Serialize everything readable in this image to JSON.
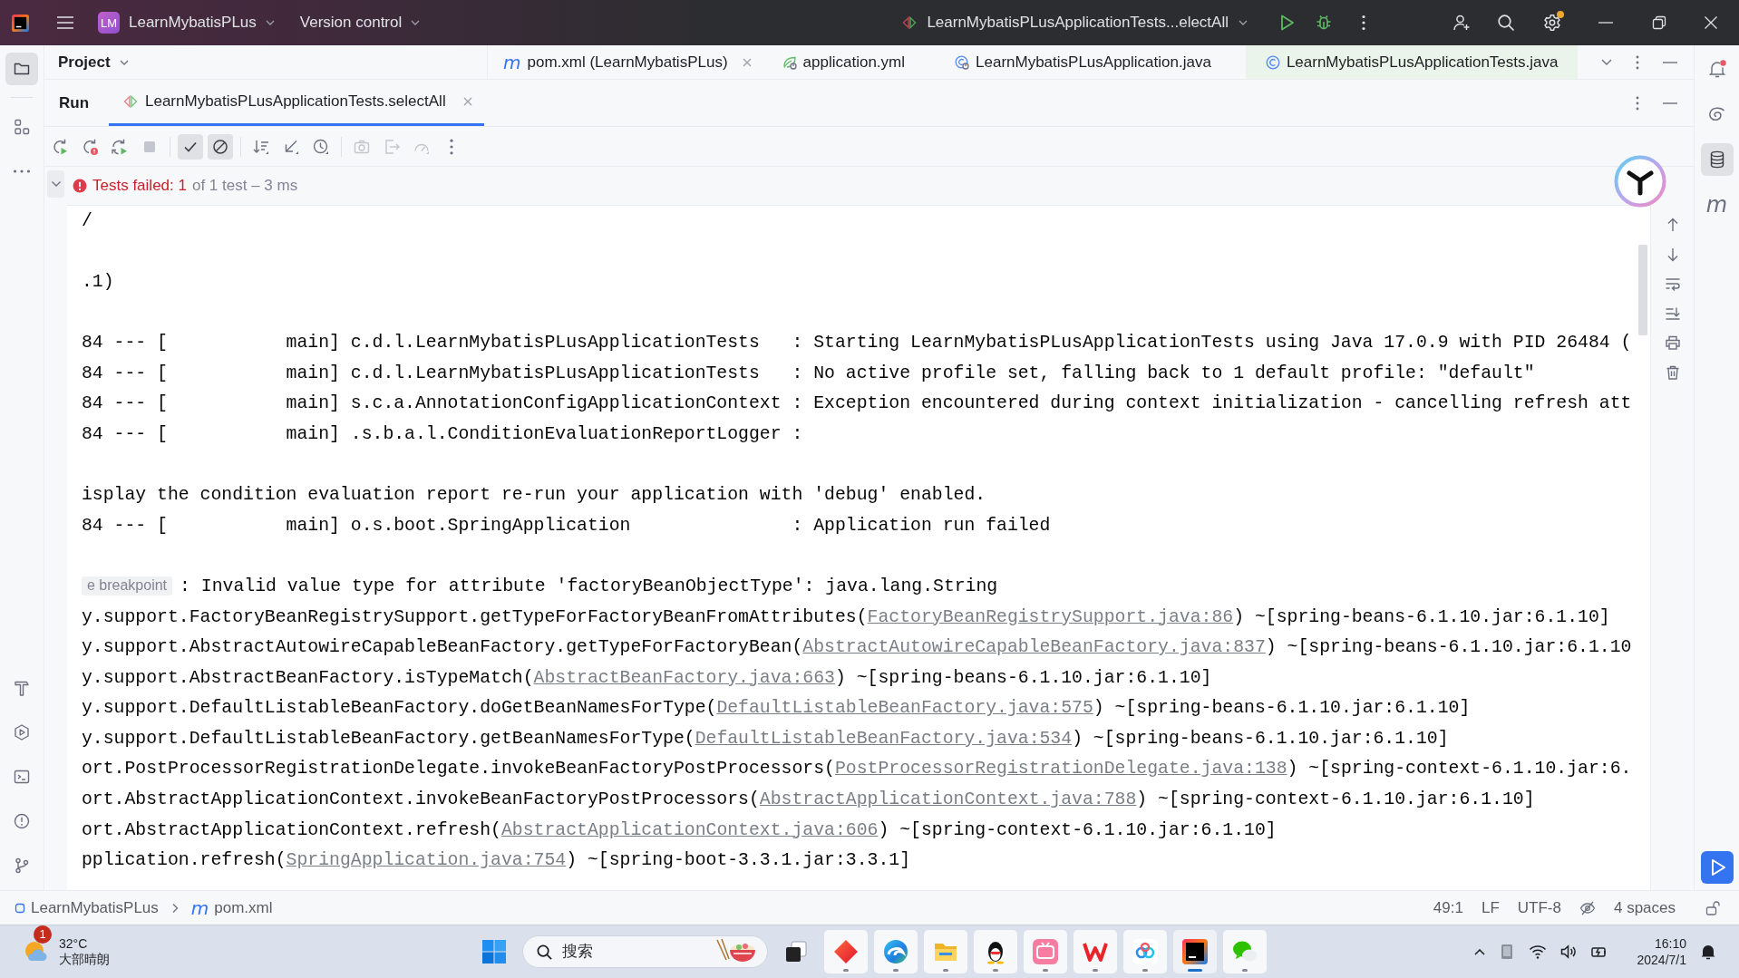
{
  "title_bar": {
    "project_badge": "LM",
    "project": "LearnMybatisPLus",
    "vcs": "Version control",
    "run_config": "LearnMybatisPLusApplicationTests...electAll",
    "settings_badge": true
  },
  "left_toolbar": [
    {
      "selected": true
    },
    {
      "selected": false
    },
    {
      "selected": false
    },
    {
      "selected": false
    },
    {
      "selected": false
    },
    {
      "selected": false
    },
    {
      "selected": false
    },
    {
      "selected": false
    }
  ],
  "project_panel": {
    "title": "Project"
  },
  "editor_tabs": [
    {
      "kind": "pom",
      "glyph": "m",
      "label": "pom.xml (LearnMybatisPLus)",
      "selected": false,
      "closable": true
    },
    {
      "kind": "config",
      "label": "application.yml",
      "selected": false,
      "closable": false
    },
    {
      "kind": "main-class",
      "label": "LearnMybatisPLusApplication.java",
      "selected": false,
      "closable": false
    },
    {
      "kind": "class",
      "label": "LearnMybatisPLusApplicationTests.java",
      "selected": true,
      "closable": false
    }
  ],
  "run_panel": {
    "title": "Run",
    "tab": {
      "label": "LearnMybatisPLusApplicationTests.selectAll",
      "selected": true,
      "closable": true
    }
  },
  "run_toolbar": [
    {
      "disabled": false,
      "selected": false
    },
    {
      "disabled": false,
      "selected": false
    },
    {
      "disabled": false,
      "selected": false
    },
    {
      "disabled": true,
      "selected": false
    },
    {
      "disabled": false,
      "selected": true
    },
    {
      "disabled": false,
      "selected": true
    },
    {
      "disabled": false,
      "selected": false
    },
    {
      "disabled": false,
      "selected": false
    },
    {
      "disabled": false,
      "selected": false
    },
    {
      "disabled": true,
      "selected": false
    },
    {
      "disabled": true,
      "selected": false
    },
    {
      "disabled": true,
      "selected": false
    },
    {
      "disabled": false,
      "selected": false
    }
  ],
  "test_status": {
    "failed": true,
    "expanded": true,
    "summary": "Tests failed: 1",
    "detail": "of 1 test – 3 ms"
  },
  "console": {
    "lines": [
      {
        "segments": [
          {
            "kind": "code",
            "text": "/"
          }
        ]
      },
      {
        "blank_line_before": true,
        "segments": [
          {
            "kind": "code",
            "text": ".1)"
          }
        ]
      },
      {
        "blank_line_before": true,
        "segments": [
          {
            "kind": "code",
            "text": "84 --- [           main] c.d.l.LearnMybatisPLusApplicationTests   : Starting LearnMybatisPLusApplicationTests using Java 17.0.9 with PID 26484 ("
          }
        ]
      },
      {
        "segments": [
          {
            "kind": "code",
            "text": "84 --- [           main] c.d.l.LearnMybatisPLusApplicationTests   : No active profile set, falling back to 1 default profile: \"default\""
          }
        ]
      },
      {
        "segments": [
          {
            "kind": "code",
            "text": "84 --- [           main] s.c.a.AnnotationConfigApplicationContext : Exception encountered during context initialization - cancelling refresh att"
          }
        ]
      },
      {
        "segments": [
          {
            "kind": "code",
            "text": "84 --- [           main] .s.b.a.l.ConditionEvaluationReportLogger :"
          }
        ]
      },
      {
        "blank_line_before": true,
        "segments": [
          {
            "kind": "code",
            "text": "isplay the condition evaluation report re-run your application with 'debug' enabled."
          }
        ]
      },
      {
        "segments": [
          {
            "kind": "code",
            "text": "84 --- [           main] o.s.boot.SpringApplication               : Application run failed"
          }
        ]
      },
      {
        "blank_line_before": true,
        "segments": [
          {
            "kind": "hint",
            "text": "e breakpoint"
          },
          {
            "kind": "code",
            "text": ": Invalid value type for attribute 'factoryBeanObjectType': java.lang.String"
          }
        ]
      },
      {
        "segments": [
          {
            "kind": "code",
            "text": "y.support.FactoryBeanRegistrySupport.getTypeForFactoryBeanFromAttributes("
          },
          {
            "kind": "link",
            "text": "FactoryBeanRegistrySupport.java:86"
          },
          {
            "kind": "code",
            "text": ") ~[spring-beans-6.1.10.jar:6.1.10]"
          }
        ]
      },
      {
        "segments": [
          {
            "kind": "code",
            "text": "y.support.AbstractAutowireCapableBeanFactory.getTypeForFactoryBean("
          },
          {
            "kind": "link",
            "text": "AbstractAutowireCapableBeanFactory.java:837"
          },
          {
            "kind": "code",
            "text": ") ~[spring-beans-6.1.10.jar:6.1.10"
          }
        ]
      },
      {
        "segments": [
          {
            "kind": "code",
            "text": "y.support.AbstractBeanFactory.isTypeMatch("
          },
          {
            "kind": "link",
            "text": "AbstractBeanFactory.java:663"
          },
          {
            "kind": "code",
            "text": ") ~[spring-beans-6.1.10.jar:6.1.10]"
          }
        ]
      },
      {
        "segments": [
          {
            "kind": "code",
            "text": "y.support.DefaultListableBeanFactory.doGetBeanNamesForType("
          },
          {
            "kind": "link",
            "text": "DefaultListableBeanFactory.java:575"
          },
          {
            "kind": "code",
            "text": ") ~[spring-beans-6.1.10.jar:6.1.10]"
          }
        ]
      },
      {
        "segments": [
          {
            "kind": "code",
            "text": "y.support.DefaultListableBeanFactory.getBeanNamesForType("
          },
          {
            "kind": "link",
            "text": "DefaultListableBeanFactory.java:534"
          },
          {
            "kind": "code",
            "text": ") ~[spring-beans-6.1.10.jar:6.1.10]"
          }
        ]
      },
      {
        "segments": [
          {
            "kind": "code",
            "text": "ort.PostProcessorRegistrationDelegate.invokeBeanFactoryPostProcessors("
          },
          {
            "kind": "link",
            "text": "PostProcessorRegistrationDelegate.java:138"
          },
          {
            "kind": "code",
            "text": ") ~[spring-context-6.1.10.jar:6."
          }
        ]
      },
      {
        "segments": [
          {
            "kind": "code",
            "text": "ort.AbstractApplicationContext.invokeBeanFactoryPostProcessors("
          },
          {
            "kind": "link",
            "text": "AbstractApplicationContext.java:788"
          },
          {
            "kind": "code",
            "text": ") ~[spring-context-6.1.10.jar:6.1.10]"
          }
        ]
      },
      {
        "segments": [
          {
            "kind": "code",
            "text": "ort.AbstractApplicationContext.refresh("
          },
          {
            "kind": "link",
            "text": "AbstractApplicationContext.java:606"
          },
          {
            "kind": "code",
            "text": ") ~[spring-context-6.1.10.jar:6.1.10]"
          }
        ]
      },
      {
        "segments": [
          {
            "kind": "code",
            "text": "pplication.refresh("
          },
          {
            "kind": "link",
            "text": "SpringApplication.java:754"
          },
          {
            "kind": "code",
            "text": ") ~[spring-boot-3.3.1.jar:3.3.1]"
          }
        ]
      }
    ]
  },
  "right_toolbar": [
    {
      "selected": false,
      "unread": true
    },
    {
      "selected": false
    },
    {
      "selected": true
    },
    {
      "selected": false,
      "glyph": "m"
    }
  ],
  "status_bar": {
    "breadcrumbs": [
      {
        "kind": "module",
        "label": "LearnMybatisPLus"
      },
      {
        "kind": "pom",
        "glyph": "m",
        "label": "pom.xml"
      }
    ],
    "position": "49:1",
    "line_separator": "LF",
    "encoding": "UTF-8",
    "indent": "4 spaces"
  },
  "taskbar": {
    "weather": {
      "badge": "1",
      "temperature": "32°C",
      "condition": "大部晴朗"
    },
    "search": {
      "placeholder": "搜索"
    },
    "apps": [
      {
        "running": true,
        "active": false
      },
      {
        "running": true,
        "active": false
      },
      {
        "running": true,
        "active": false
      },
      {
        "running": true,
        "active": false
      },
      {
        "running": true,
        "active": false
      },
      {
        "running": true,
        "active": false
      },
      {
        "running": true,
        "active": false
      },
      {
        "running": true,
        "active": true
      },
      {
        "running": true,
        "active": false
      }
    ],
    "clock": {
      "time": "16:10",
      "date": "2024/7/1"
    }
  }
}
